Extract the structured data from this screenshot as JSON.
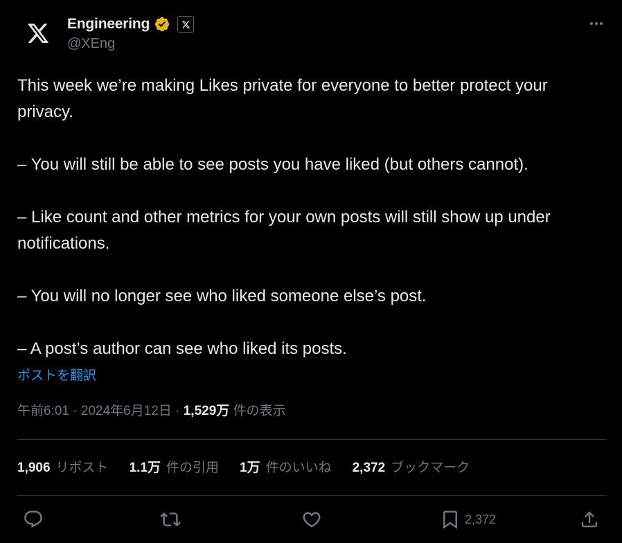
{
  "author": {
    "display_name": "Engineering",
    "handle": "@XEng",
    "avatar_icon": "x-logo-icon",
    "verified_badge_icon": "gold-verified-badge-icon",
    "affiliation_icon": "x-affiliation-icon"
  },
  "post": {
    "lines": [
      "This week we’re making Likes private for everyone to better protect your privacy.",
      "– You will still be able to see posts you have liked (but others cannot).",
      "– Like count and other metrics for your own posts will still show up under notifications.",
      "– You will no longer see who liked someone else’s post.",
      "– A post’s author can see who liked its posts."
    ],
    "translate_label": "ポストを翻訳"
  },
  "meta": {
    "time": "午前6:01",
    "separator": " · ",
    "date": "2024年6月12日",
    "views_count": "1,529万",
    "views_label": "件の表示"
  },
  "stats": [
    {
      "num": "1,906",
      "label": "リポスト"
    },
    {
      "num": "1.1万",
      "label": "件の引用"
    },
    {
      "num": "1万",
      "label": "件のいいね"
    },
    {
      "num": "2,372",
      "label": "ブックマーク"
    }
  ],
  "actions": {
    "bookmark_count": "2,372"
  },
  "colors": {
    "background": "#000000",
    "text": "#e7e9ea",
    "secondary": "#71767b",
    "accent": "#1d9bf0",
    "verified_gold": "#e2b719",
    "divider": "#2f3336"
  }
}
